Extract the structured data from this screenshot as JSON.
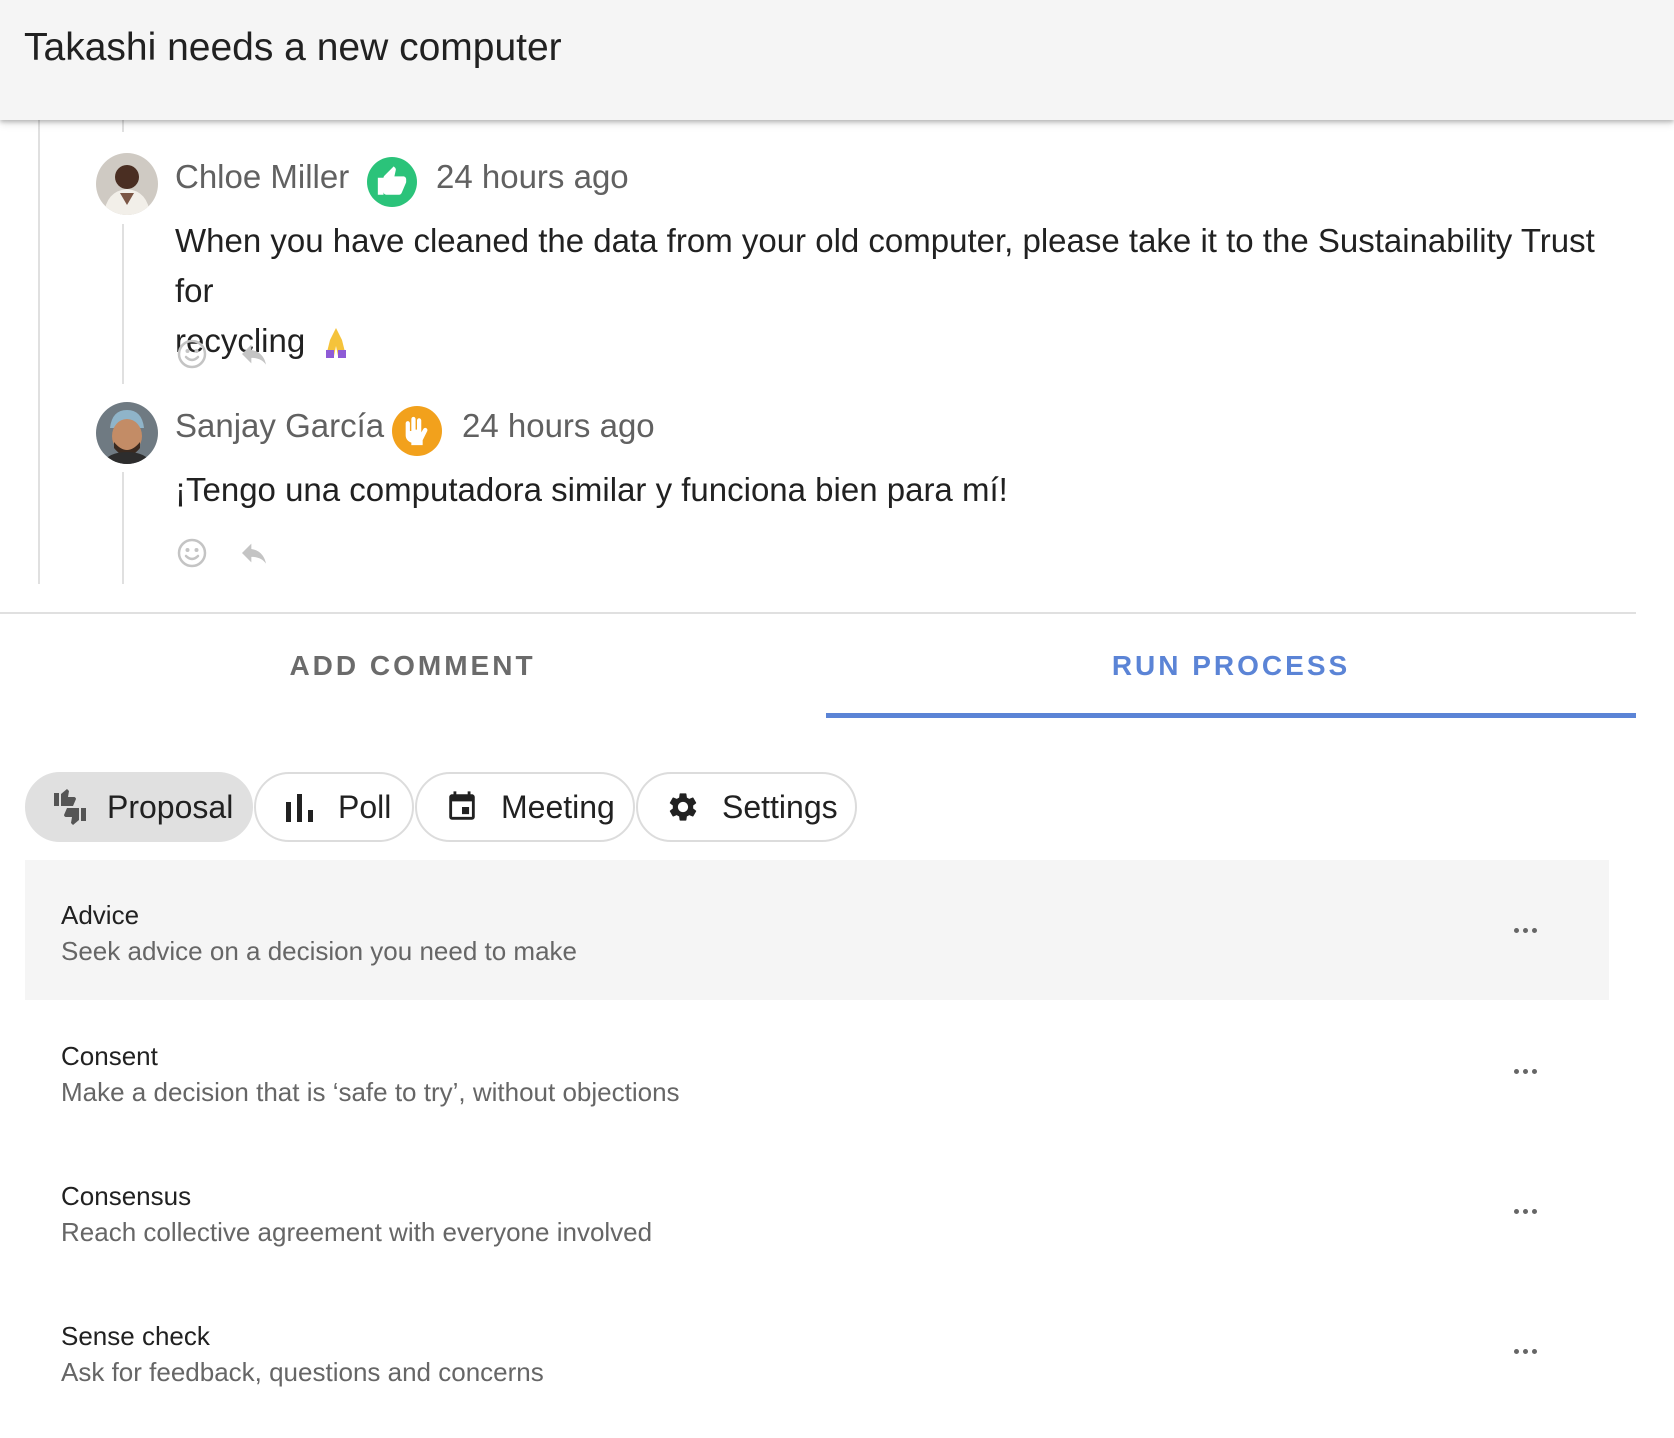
{
  "header": {
    "title": "Takashi needs a new computer"
  },
  "comments": [
    {
      "author": "Chloe Miller",
      "stance_icon": "thumbs-up-icon",
      "stance_color": "#2bc37a",
      "time": "24 hours ago",
      "body_line1": "When you have cleaned the data from your old computer, please take it to the Sustainability Trust for",
      "body_line2": "recycling",
      "emoji_icon": "folded-hands-icon"
    },
    {
      "author": "Sanjay García",
      "stance_icon": "raised-hand-icon",
      "stance_color": "#f2a11c",
      "time": "24 hours ago",
      "body_line1": "¡Tengo una computadora similar y funciona bien para mí!"
    }
  ],
  "tabs": [
    {
      "label": "ADD COMMENT",
      "active": false
    },
    {
      "label": "RUN PROCESS",
      "active": true
    }
  ],
  "accent_color": "#5b84d6",
  "chips": [
    {
      "label": "Proposal",
      "icon": "proposal-thumbs-icon",
      "selected": true
    },
    {
      "label": "Poll",
      "icon": "bar-chart-icon",
      "selected": false
    },
    {
      "label": "Meeting",
      "icon": "calendar-icon",
      "selected": false
    },
    {
      "label": "Settings",
      "icon": "gear-icon",
      "selected": false
    }
  ],
  "templates": [
    {
      "title": "Advice",
      "description": "Seek advice on a decision you need to make"
    },
    {
      "title": "Consent",
      "description": "Make a decision that is ‘safe to try’, without objections"
    },
    {
      "title": "Consensus",
      "description": "Reach collective agreement with everyone involved"
    },
    {
      "title": "Sense check",
      "description": "Ask for feedback, questions and concerns"
    }
  ]
}
